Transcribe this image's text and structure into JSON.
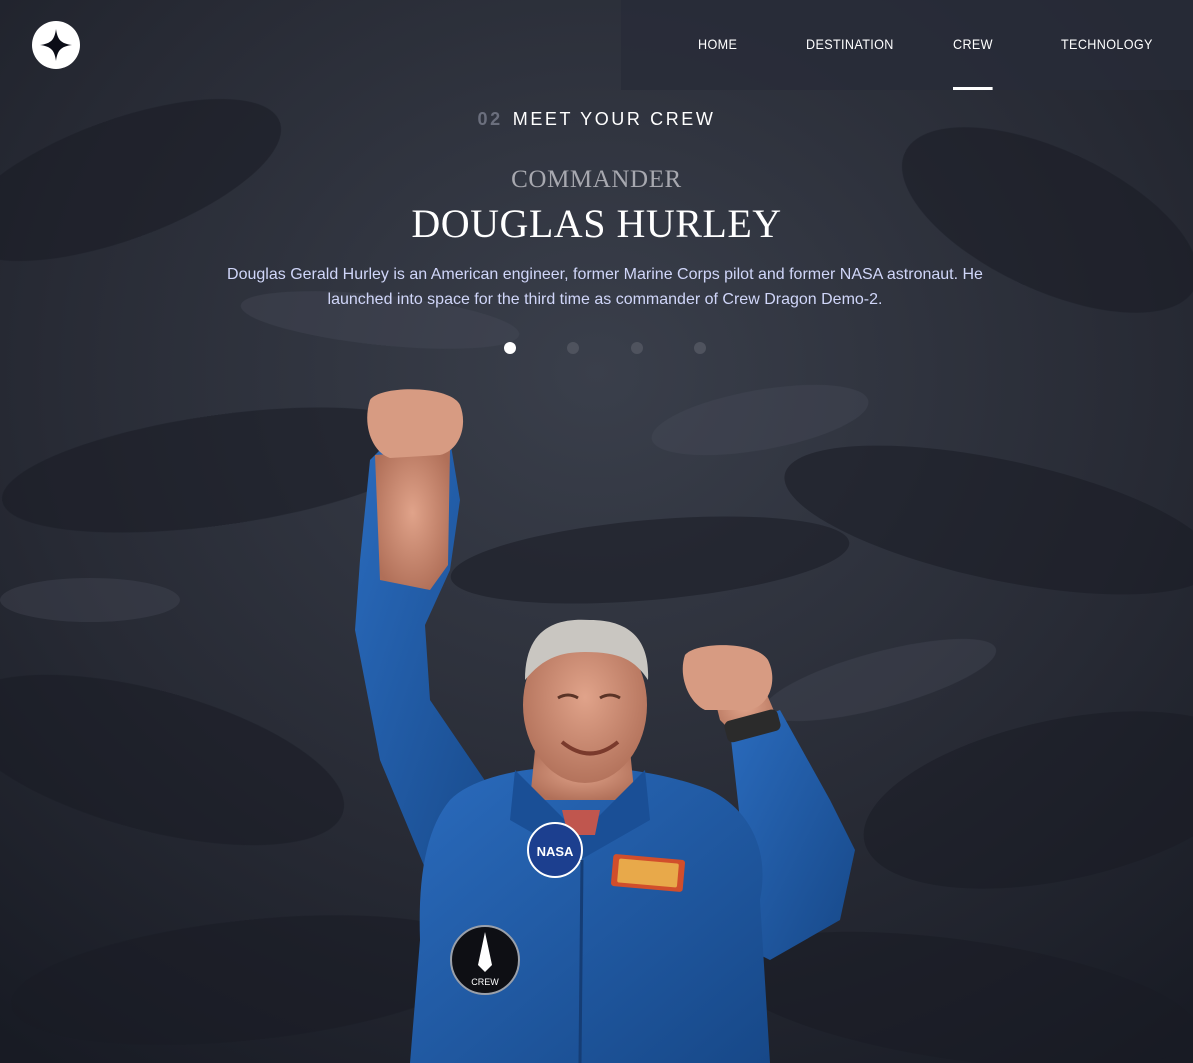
{
  "nav": {
    "items": [
      {
        "label": "HOME",
        "active": false
      },
      {
        "label": "DESTINATION",
        "active": false
      },
      {
        "label": "CREW",
        "active": true
      },
      {
        "label": "TECHNOLOGY",
        "active": false
      }
    ]
  },
  "header": {
    "number": "02",
    "title": "MEET YOUR CREW"
  },
  "crew": {
    "role": "COMMANDER",
    "name": "DOUGLAS HURLEY",
    "bio": "Douglas Gerald Hurley is an American engineer, former Marine Corps pilot and former NASA astronaut. He launched into space for the third time as commander of Crew Dragon Demo-2.",
    "slide_count": 4,
    "active_slide": 1
  },
  "patches": {
    "nasa": "NASA",
    "crew": "CREW"
  },
  "colors": {
    "background": "#1b1e29",
    "accent": "#ffffff",
    "bio_text": "#d0d6f9",
    "suit": "#1f5aa6"
  }
}
